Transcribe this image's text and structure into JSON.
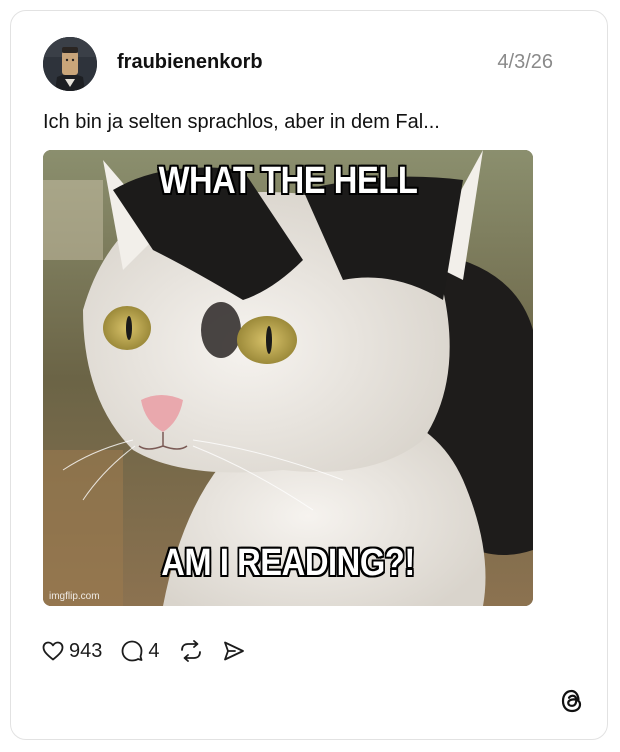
{
  "post": {
    "username": "fraubienenkorb",
    "timestamp": "4/3/26",
    "text": "Ich bin ja selten sprachlos, aber in dem Fal...",
    "image": {
      "top_text": "WHAT THE HELL",
      "bottom_text": "AM I READING?!",
      "watermark": "imgflip.com"
    },
    "actions": {
      "likes": "943",
      "replies": "4"
    }
  },
  "icons": {
    "like": "heart-icon",
    "reply": "comment-icon",
    "repost": "repost-icon",
    "share": "send-icon",
    "brand": "threads-logo-icon"
  },
  "colors": {
    "text": "#111111",
    "muted": "#8a8a8a",
    "border": "#e2e2e2"
  }
}
